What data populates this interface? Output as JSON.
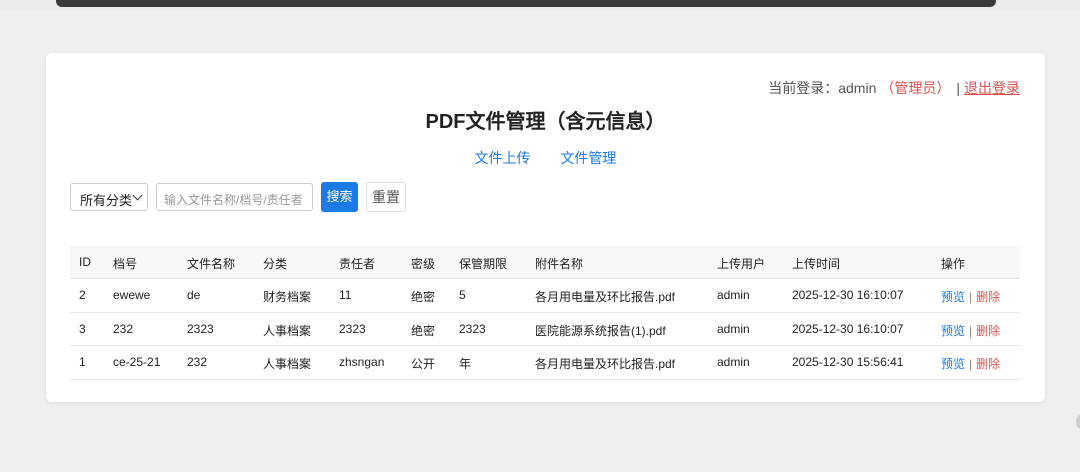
{
  "header": {
    "login_prefix": "当前登录：admin",
    "role": "（管理员）",
    "separator": "|",
    "logout": "退出登录"
  },
  "title": "PDF文件管理（含元信息）",
  "nav": {
    "upload": "文件上传",
    "manage": "文件管理"
  },
  "filters": {
    "category_selected": "所有分类",
    "search_placeholder": "输入文件名称/档号/责任者",
    "search_button": "搜索",
    "reset_button": "重置"
  },
  "table": {
    "columns": [
      "ID",
      "档号",
      "文件名称",
      "分类",
      "责任者",
      "密级",
      "保管期限",
      "附件名称",
      "上传用户",
      "上传时间",
      "操作"
    ],
    "rows": [
      [
        "2",
        "ewewe",
        "de",
        "财务档案",
        "11",
        "绝密",
        "5",
        "各月用电量及环比报告.pdf",
        "admin",
        "2025-12-30 16:10:07"
      ],
      [
        "3",
        "232",
        "2323",
        "人事档案",
        "2323",
        "绝密",
        "2323",
        "医院能源系统报告(1).pdf",
        "admin",
        "2025-12-30 16:10:07"
      ],
      [
        "1",
        "ce-25-21",
        "232",
        "人事档案",
        "zhsngan",
        "公开",
        "年",
        "各月用电量及环比报告.pdf",
        "admin",
        "2025-12-30 15:56:41"
      ]
    ],
    "op_preview": "预览",
    "op_sep": "|",
    "op_delete": "删除"
  },
  "colors": {
    "accent": "#1a7ae6",
    "danger": "#d9534f",
    "background": "#efefef"
  }
}
